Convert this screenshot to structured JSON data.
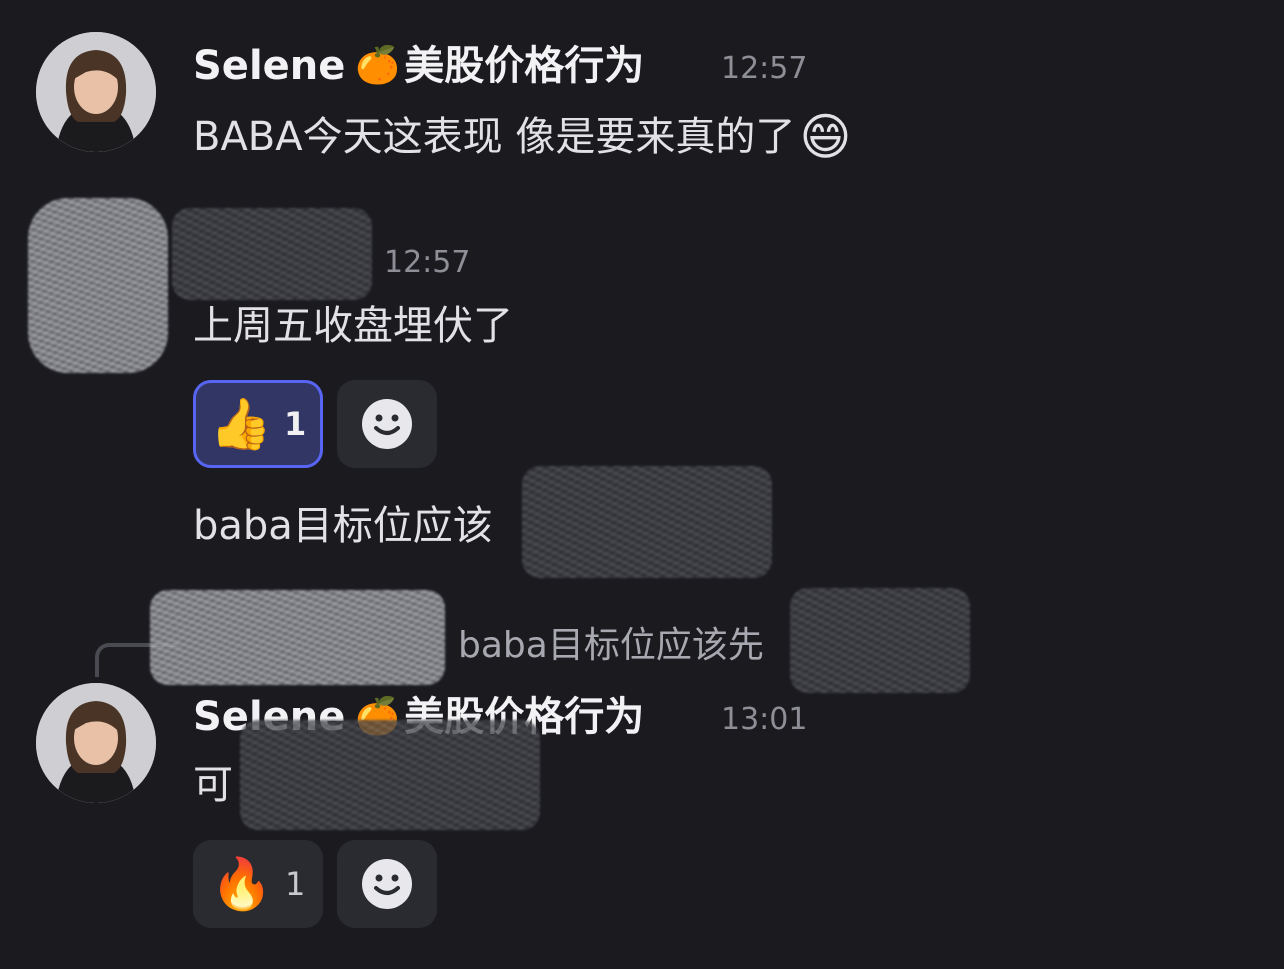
{
  "messages": [
    {
      "author": "Selene",
      "author_emoji": "🍊",
      "role_text": "美股价格行为",
      "time": "12:57",
      "text": "BABA今天这表现 像是要来真的了",
      "text_emoji": "😄"
    },
    {
      "author": "",
      "time": "12:57",
      "text": "上周五收盘埋伏了",
      "reactions": [
        {
          "emoji": "👍",
          "count": "1",
          "active": true
        }
      ],
      "followup_text": "baba目标位应该"
    },
    {
      "reply_preview": "baba目标位应该先",
      "author": "Selene",
      "author_emoji": "🍊",
      "role_text": "美股价格行为",
      "time": "13:01",
      "text": "可",
      "reactions": [
        {
          "emoji": "🔥",
          "count": "1",
          "active": false
        }
      ]
    }
  ],
  "add_reaction_icon": "add-reaction-smiley-icon",
  "colors": {
    "background": "#1a1a1f",
    "reaction_active_bg": "#313665",
    "reaction_active_border": "#5865f2",
    "reaction_bg": "#2a2b31"
  }
}
